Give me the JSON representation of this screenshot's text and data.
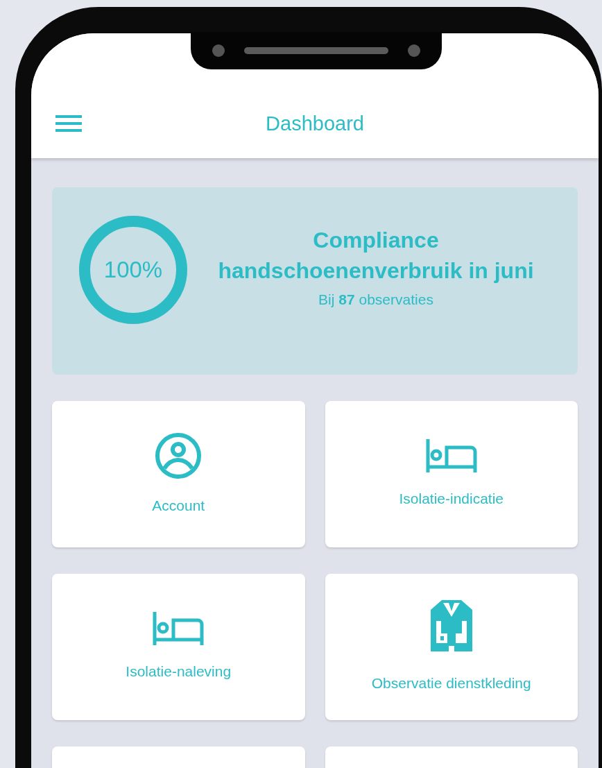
{
  "header": {
    "title": "Dashboard"
  },
  "summary": {
    "level": 1.0,
    "percent": "100%",
    "title": "Compliance handschoenenverbruik in juni",
    "subtitle": "Bij **87** observaties"
  },
  "tiles": [
    {
      "kind": "person",
      "label": "Account"
    },
    {
      "kind": "bed",
      "label": "Isolatie-indicatie"
    },
    {
      "kind": "bed",
      "label": "Isolatie-naleving"
    },
    {
      "kind": "jacket",
      "label": "Observatie dienstkleding"
    },
    {
      "kind": "blank"
    },
    {
      "kind": "blank"
    }
  ]
}
